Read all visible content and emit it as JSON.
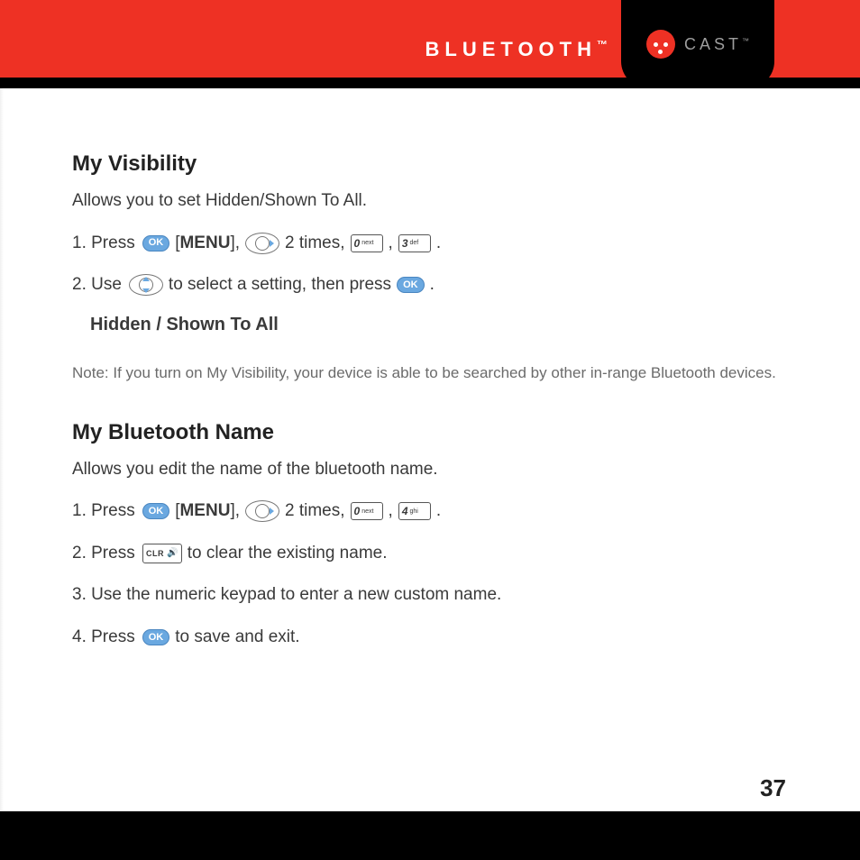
{
  "header": {
    "section_title": "BLUETOOTH",
    "title_tm": "™",
    "brand": "CAST",
    "brand_tm": "™"
  },
  "icons": {
    "ok": "OK",
    "clr": "CLR",
    "key0": {
      "digit": "0",
      "sub": "next"
    },
    "key3": {
      "digit": "3",
      "sub": "def"
    },
    "key4": {
      "digit": "4",
      "sub": "ghi"
    }
  },
  "section1": {
    "heading": "My Visibility",
    "desc": "Allows you to set Hidden/Shown To All.",
    "step1_a": "1. Press",
    "menu_label": "MENU",
    "step1_b": "2 times,",
    "step2_a": "2. Use",
    "step2_b": "to select a setting, then press",
    "options": "Hidden / Shown To All",
    "note": "Note: If you turn on My Visibility, your device is able to be searched by other in-range Bluetooth devices."
  },
  "section2": {
    "heading": "My Bluetooth Name",
    "desc": "Allows you edit the name of the bluetooth name.",
    "step1_a": "1. Press",
    "menu_label": "MENU",
    "step1_b": "2 times,",
    "step2_a": "2. Press",
    "step2_b": "to clear the existing name.",
    "step3": "3. Use the numeric keypad to enter a new custom name.",
    "step4_a": "4. Press",
    "step4_b": "to save and exit."
  },
  "page_number": "37"
}
